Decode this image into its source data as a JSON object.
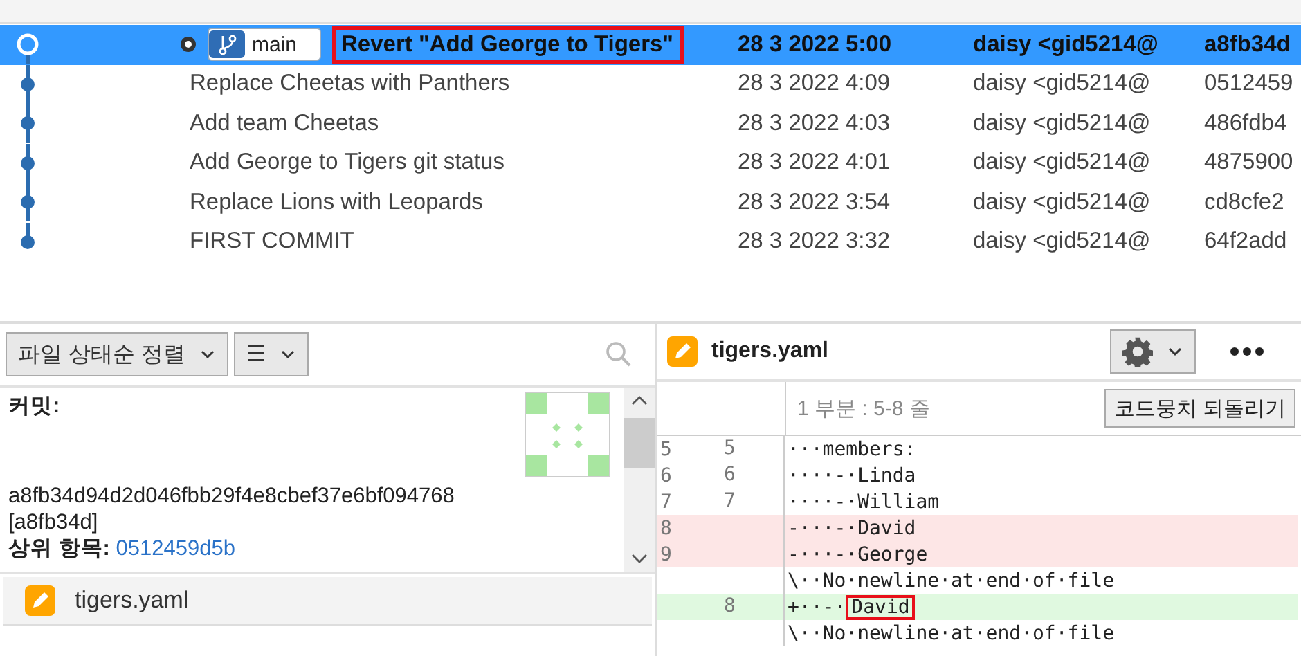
{
  "commits": [
    {
      "description": "Revert \"Add George to Tigers\"",
      "date": "28 3 2022 5:00",
      "author": "daisy <gid5214@",
      "hash": "a8fb34d",
      "selected": true,
      "head": true,
      "branch": "main",
      "highlighted": true
    },
    {
      "description": "Replace Cheetas with Panthers",
      "date": "28 3 2022 4:09",
      "author": "daisy <gid5214@",
      "hash": "0512459",
      "selected": false,
      "head": false,
      "highlighted": false
    },
    {
      "description": "Add team Cheetas",
      "date": "28 3 2022 4:03",
      "author": "daisy <gid5214@",
      "hash": "486fdb4",
      "selected": false,
      "head": false,
      "highlighted": false
    },
    {
      "description": "Add George to Tigers git status",
      "date": "28 3 2022 4:01",
      "author": "daisy <gid5214@",
      "hash": "4875900",
      "selected": false,
      "head": false,
      "highlighted": false
    },
    {
      "description": "Replace Lions with Leopards",
      "date": "28 3 2022 3:54",
      "author": "daisy <gid5214@",
      "hash": "cd8cfe2",
      "selected": false,
      "head": false,
      "highlighted": false
    },
    {
      "description": "FIRST COMMIT",
      "date": "28 3 2022 3:32",
      "author": "daisy <gid5214@",
      "hash": "64f2add",
      "selected": false,
      "head": false,
      "highlighted": false
    }
  ],
  "file_toolbar": {
    "sort_dropdown": "파일 상태순 정렬",
    "view_dropdown": "☰"
  },
  "details": {
    "commit_label": "커밋:",
    "full_hash": "a8fb34d94d2d046fbb29f4e8cbef37e6bf094768",
    "short_hash": "[a8fb34d]",
    "parent_label": "상위 항목:",
    "parent_hash": "0512459d5b"
  },
  "files": [
    {
      "name": "tigers.yaml"
    }
  ],
  "diff": {
    "file": "tigers.yaml",
    "hunk_title": "1 부분 : 5-8 줄",
    "revert_button": "코드뭉치 되돌리기",
    "lines": [
      {
        "kind": "context",
        "old": "5",
        "new": "5",
        "text": "···members:"
      },
      {
        "kind": "context",
        "old": "6",
        "new": "6",
        "text": "····-·Linda"
      },
      {
        "kind": "context",
        "old": "7",
        "new": "7",
        "text": "····-·William"
      },
      {
        "kind": "removed",
        "old": "8",
        "text": "-···-·David"
      },
      {
        "kind": "removed",
        "old": "9",
        "text": "-···-·George"
      },
      {
        "kind": "context",
        "text": "\\··No·newline·at·end·of·file"
      },
      {
        "kind": "added",
        "new": "8",
        "text": "+··-·",
        "highlight": "David"
      },
      {
        "kind": "context",
        "text": "\\··No·newline·at·end·of·file"
      }
    ]
  }
}
